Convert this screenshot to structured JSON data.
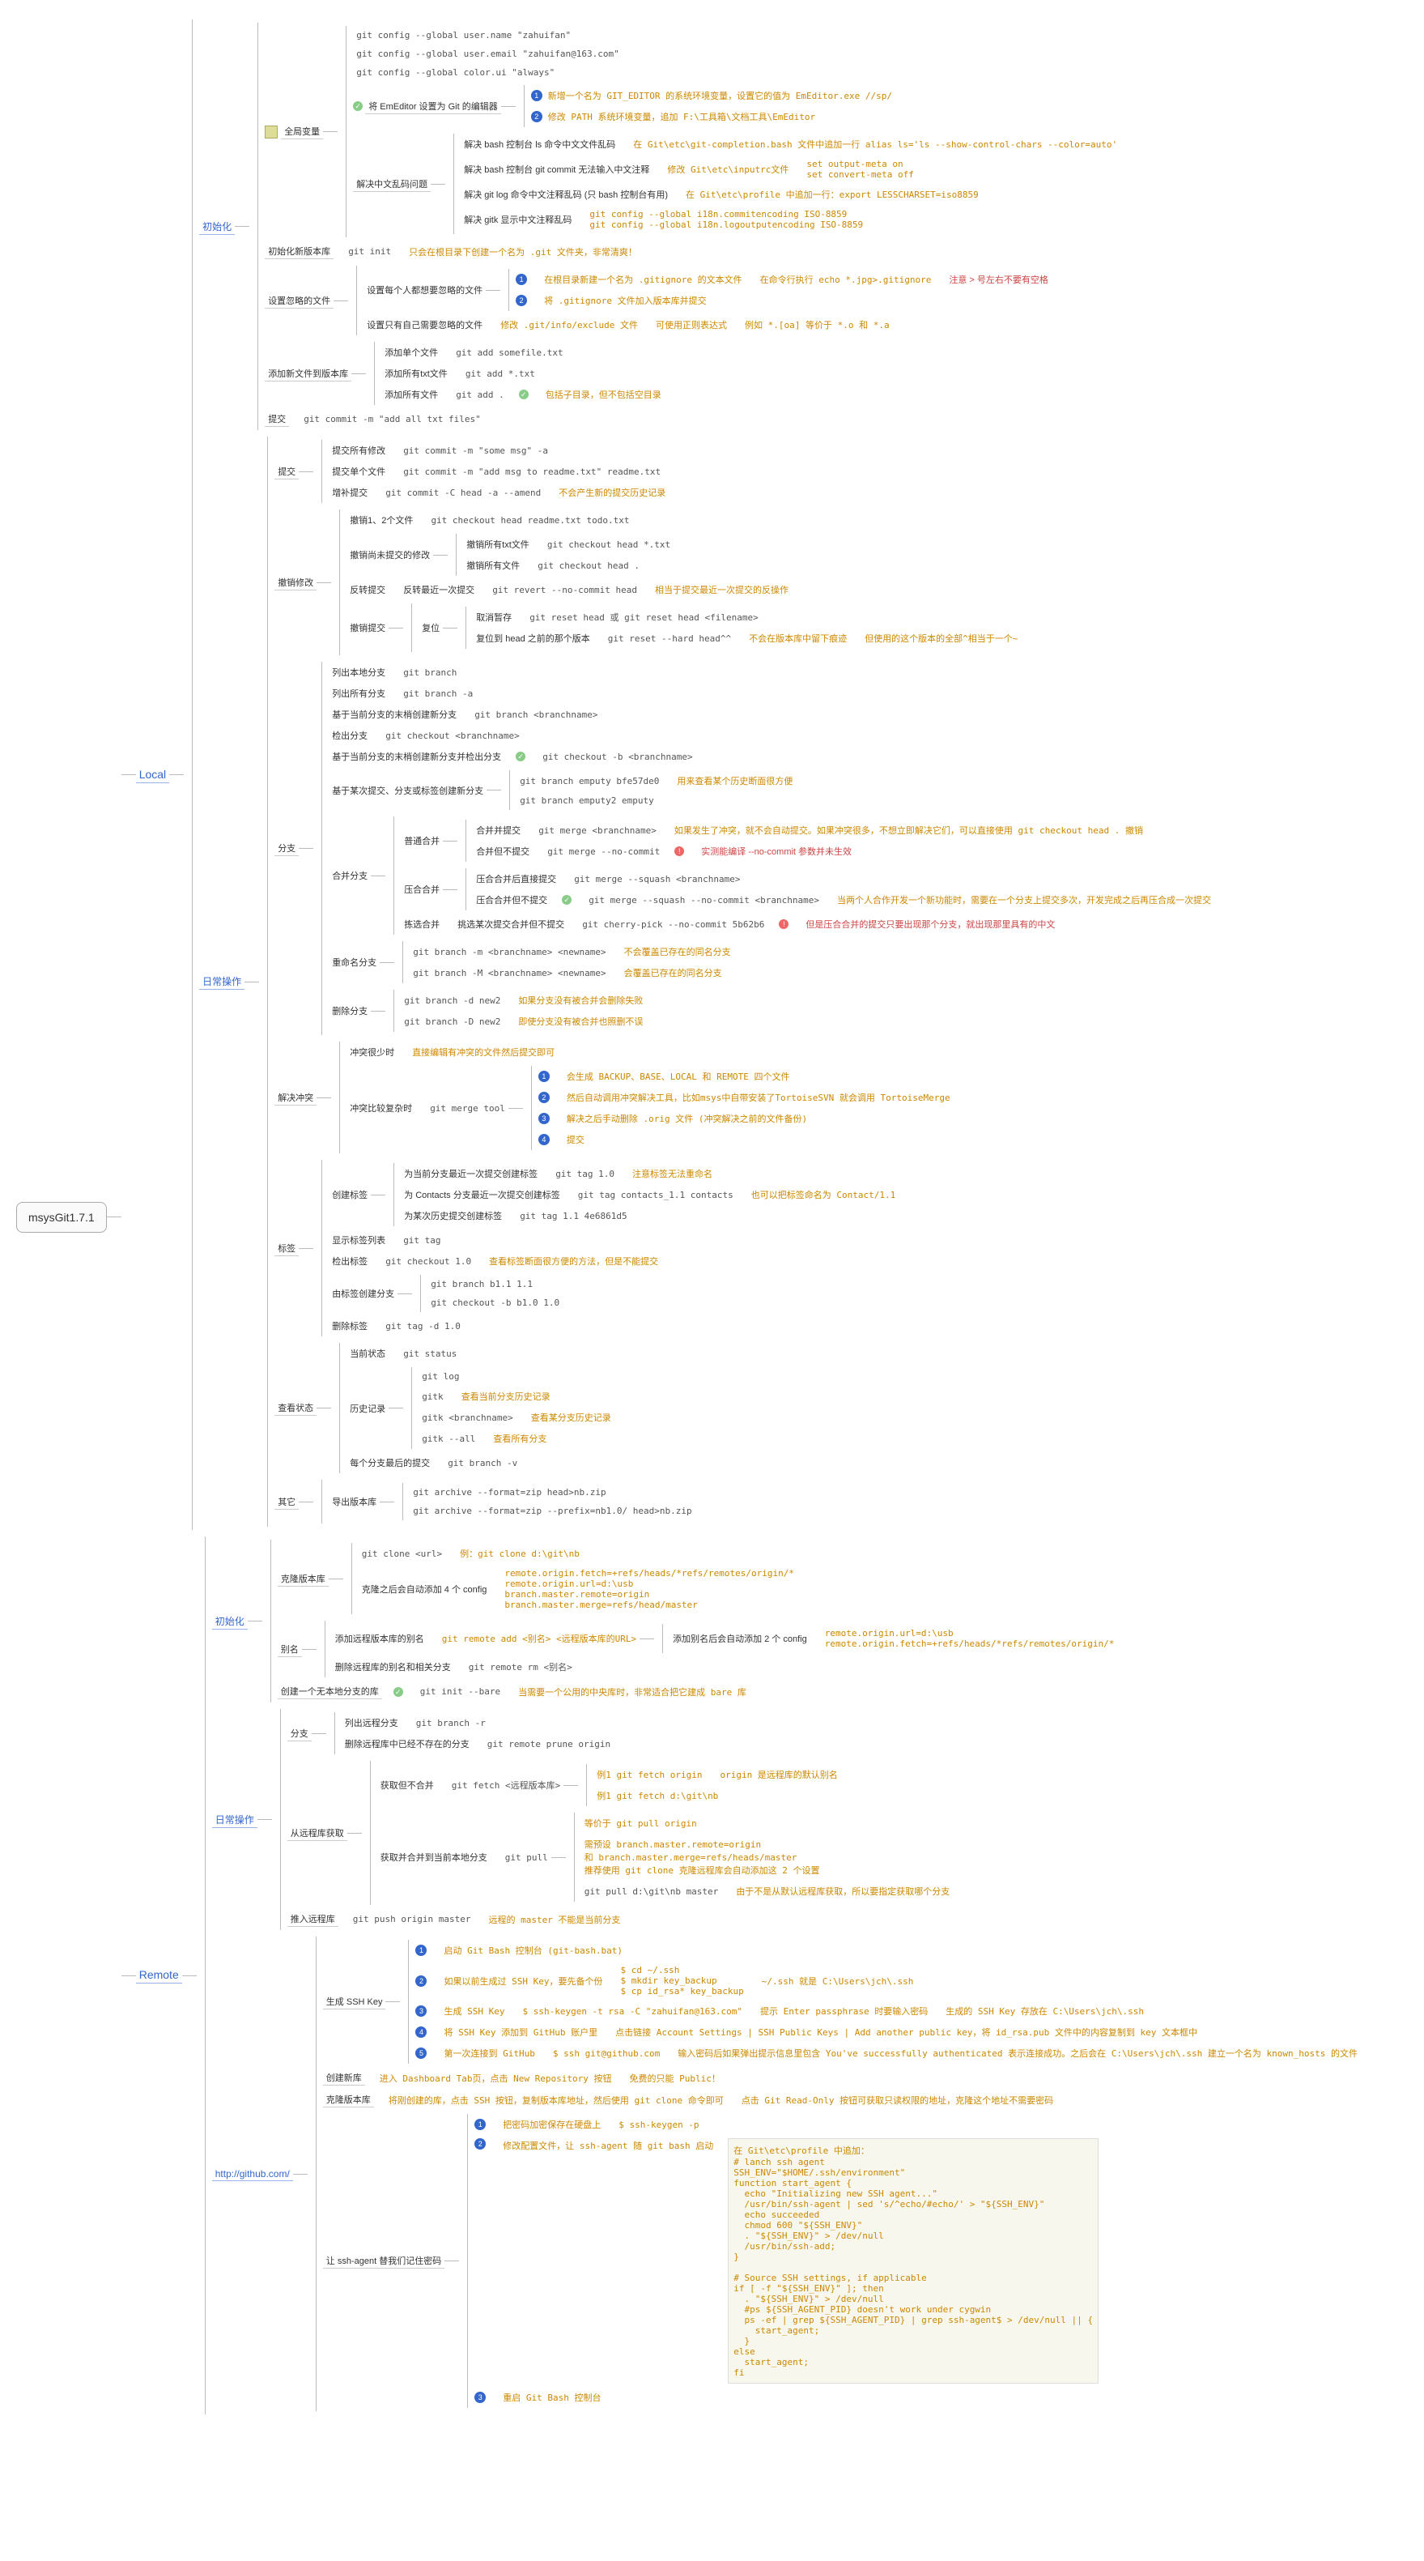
{
  "root": {
    "title": "msysGit1.7.1"
  },
  "local": {
    "title": "Local",
    "init": {
      "title": "初始化",
      "global": {
        "title": "全局变量",
        "cmds": [
          "git config --global user.name \"zahuifan\"",
          "git config --global user.email \"zahuifan@163.com\"",
          "git config --global color.ui \"always\""
        ],
        "editor": {
          "label": "将 EmEditor 设置为 Git 的编辑器",
          "s1": "新增一个名为 GIT_EDITOR 的系统环境变量，设置它的值为 EmEditor.exe //sp/",
          "s2": "修改 PATH 系统环境变量，追加 F:\\工具箱\\文档工具\\EmEditor"
        },
        "zh": {
          "label": "解决中文乱码问题",
          "r1": {
            "l": "解决 bash 控制台 ls 命令中文文件乱码",
            "c": "在 Git\\etc\\git-completion.bash 文件中追加一行 alias ls='ls --show-control-chars --color=auto'"
          },
          "r2": {
            "l": "解决 bash 控制台 git commit 无法输入中文注释",
            "c1": "修改 Git\\etc\\inputrc文件",
            "c2": "set output-meta on\nset convert-meta off"
          },
          "r3": {
            "l": "解决 git log 命令中文注释乱码 (只 bash 控制台有用)",
            "c": "在 Git\\etc\\profile 中追加一行：export LESSCHARSET=iso8859"
          },
          "r4": {
            "l": "解决 gitk 显示中文注释乱码",
            "c": "git config --global i18n.commitencoding ISO-8859\ngit config --global i18n.logoutputencoding ISO-8859"
          }
        }
      },
      "newrepo": {
        "title": "初始化新版本库",
        "cmd": "git init",
        "note": "只会在根目录下创建一个名为 .git 文件夹，非常清爽！"
      },
      "ignore": {
        "title": "设置忽略的文件",
        "common": {
          "l": "设置每个人都想要忽略的文件",
          "s1": "在根目录新建一个名为 .gitignore 的文本文件",
          "s1c": "在命令行执行 echo *.jpg>.gitignore",
          "s1n": "注意 > 号左右不要有空格",
          "s2": "将 .gitignore 文件加入版本库并提交"
        },
        "self": {
          "l": "设置只有自己需要忽略的文件",
          "c": "修改 .git/info/exclude 文件",
          "n": "可使用正则表达式",
          "e": "例如 *.[oa] 等价于 *.o 和 *.a"
        }
      },
      "add": {
        "title": "添加新文件到版本库",
        "r1": {
          "l": "添加单个文件",
          "c": "git add somefile.txt"
        },
        "r2": {
          "l": "添加所有txt文件",
          "c": "git add *.txt"
        },
        "r3": {
          "l": "添加所有文件",
          "c": "git add .",
          "n": "包括子目录，但不包括空目录"
        }
      },
      "commit": {
        "title": "提交",
        "c": "git commit -m \"add all txt files\""
      }
    },
    "daily": {
      "title": "日常操作",
      "commit": {
        "title": "提交",
        "r1": {
          "l": "提交所有修改",
          "c": "git commit -m \"some msg\" -a"
        },
        "r2": {
          "l": "提交单个文件",
          "c": "git commit -m \"add msg to readme.txt\" readme.txt"
        },
        "r3": {
          "l": "增补提交",
          "c": "git commit -C head -a --amend",
          "n": "不会产生新的提交历史记录"
        }
      },
      "undo": {
        "title": "撤销修改",
        "r1": {
          "l": "撤销1、2个文件",
          "c": "git checkout head readme.txt todo.txt"
        },
        "r2": {
          "l": "撤销尚未提交的修改",
          "sub1": {
            "l": "撤销所有txt文件",
            "c": "git checkout head *.txt"
          },
          "sub2": {
            "l": "撤销所有文件",
            "c": "git checkout head ."
          }
        },
        "r3": {
          "l": "反转提交",
          "sub": {
            "l": "反转最近一次提交",
            "c": "git revert --no-commit head",
            "n": "相当于提交最近一次提交的反操作"
          }
        },
        "r4": {
          "l": "撤销提交",
          "sub1": {
            "l": "复位",
            "sub11": {
              "l": "取消暂存",
              "c": "git reset head 或 git reset head <filename>"
            },
            "sub12": {
              "l": "复位到 head 之前的那个版本",
              "c": "git reset --hard head^^",
              "n1": "不会在版本库中留下痕迹",
              "n2": "但使用的这个版本的全部^相当于一个~"
            }
          }
        }
      },
      "branch": {
        "title": "分支",
        "list": {
          "l": "列出本地分支",
          "c": "git branch"
        },
        "lista": {
          "l": "列出所有分支",
          "c": "git branch -a"
        },
        "new": {
          "l": "基于当前分支的末梢创建新分支",
          "c": "git branch <branchname>"
        },
        "co": {
          "l": "检出分支",
          "c": "git checkout <branchname>"
        },
        "newco": {
          "l": "基于当前分支的末梢创建新分支并检出分支",
          "c": "git checkout -b <branchname>"
        },
        "base": {
          "l": "基于某次提交、分支或标签创建新分支",
          "c1": "git branch emputy bfe57de0",
          "n1": "用来查看某个历史断面很方便",
          "c2": "git branch emputy2 emputy"
        },
        "merge": {
          "title": "合并分支",
          "m1": {
            "l": "普通合并",
            "s1": {
              "l": "合并并提交",
              "c": "git merge <branchname>",
              "n": "如果发生了冲突，就不会自动提交。如果冲突很多，不想立即解决它们，可以直接使用 git checkout head . 撤销"
            },
            "s2": {
              "l": "合并但不提交",
              "c": "git merge --no-commit",
              "w": "实测能编译 --no-commit 参数并未生效"
            }
          },
          "m2": {
            "l": "压合合并",
            "s1": {
              "l": "压合合并后直接提交",
              "c": "git merge --squash <branchname>"
            },
            "s2": {
              "l": "压合合并但不提交",
              "c": "git merge --squash --no-commit <branchname>",
              "n": "当两个人合作开发一个新功能时，需要在一个分支上提交多次，开发完成之后再压合成一次提交"
            }
          },
          "m3": {
            "l": "拣选合并",
            "s": {
              "l": "挑选某次提交合并但不提交",
              "c": "git cherry-pick --no-commit 5b62b6",
              "w": "但是压合合并的提交只要出现那个分支，就出现那里具有的中文"
            }
          }
        },
        "rename": {
          "title": "重命名分支",
          "c1": {
            "c": "git branch -m <branchname> <newname>",
            "n": "不会覆盖已存在的同名分支"
          },
          "c2": {
            "c": "git branch -M <branchname> <newname>",
            "n": "会覆盖已存在的同名分支"
          }
        },
        "del": {
          "title": "删除分支",
          "c1": {
            "c": "git branch -d new2",
            "n": "如果分支没有被合并会删除失败"
          },
          "c2": {
            "c": "git branch -D new2",
            "n": "即使分支没有被合并也照删不误"
          }
        }
      },
      "conflict": {
        "title": "解决冲突",
        "r1": {
          "l": "冲突很少时",
          "n": "直接编辑有冲突的文件然后提交即可"
        },
        "r2": {
          "l": "冲突比较复杂时",
          "c": "git merge tool",
          "s1": "会生成 BACKUP、BASE、LOCAL 和 REMOTE 四个文件",
          "s2": "然后自动调用冲突解决工具，比如msys中自带安装了TortoiseSVN 就会调用 TortoiseMerge",
          "s3": "解决之后手动删除 .orig 文件 (冲突解决之前的文件备份)",
          "s4": "提交"
        }
      },
      "tag": {
        "title": "标签",
        "new": {
          "title": "创建标签",
          "r1": {
            "l": "为当前分支最近一次提交创建标签",
            "c": "git tag 1.0",
            "n": "注意标签无法重命名"
          },
          "r2": {
            "l": "为 Contacts 分支最近一次提交创建标签",
            "c": "git tag contacts_1.1 contacts",
            "n": "也可以把标签命名为 Contact/1.1"
          },
          "r3": {
            "l": "为某次历史提交创建标签",
            "c": "git tag 1.1 4e6861d5"
          }
        },
        "show": {
          "l": "显示标签列表",
          "c": "git tag"
        },
        "coTag": {
          "l": "检出标签",
          "c": "git checkout 1.0",
          "n": "查看标签断面很方便的方法，但是不能提交"
        },
        "fromTag": {
          "l": "由标签创建分支",
          "c1": "git branch b1.1 1.1",
          "c2": "git checkout -b b1.0 1.0"
        },
        "delTag": {
          "l": "删除标签",
          "c": "git tag -d 1.0"
        }
      },
      "status": {
        "title": "查看状态",
        "cur": {
          "l": "当前状态",
          "c": "git status"
        },
        "hist": {
          "l": "历史记录",
          "c": "git log",
          "sub1": {
            "l": "gitk",
            "n": "查看当前分支历史记录"
          },
          "sub2": {
            "l": "gitk <branchname>",
            "n": "查看某分支历史记录"
          },
          "sub3": {
            "l": "gitk --all",
            "n": "查看所有分支"
          }
        },
        "last": {
          "l": "每个分支最后的提交",
          "c": "git branch -v"
        }
      },
      "other": {
        "title": "其它",
        "export": {
          "l": "导出版本库",
          "c1": "git archive --format=zip head>nb.zip",
          "c2": "git archive --format=zip --prefix=nb1.0/ head>nb.zip"
        }
      }
    }
  },
  "remote": {
    "title": "Remote",
    "init": {
      "title": "初始化",
      "clone": {
        "title": "克隆版本库",
        "c": "git clone <url>",
        "e": "例：git clone d:\\git\\nb",
        "cfg": {
          "l": "克隆之后会自动添加 4 个 config",
          "v": "remote.origin.fetch=+refs/heads/*refs/remotes/origin/*\nremote.origin.url=d:\\usb\nbranch.master.remote=origin\nbranch.master.merge=refs/head/master"
        }
      },
      "alias": {
        "title": "别名",
        "add": {
          "l": "添加远程版本库的别名",
          "c": "git remote add <别名> <远程版本库的URL>",
          "cfg": {
            "l": "添加别名后会自动添加 2 个 config",
            "v": "remote.origin.url=d:\\usb\nremote.origin.fetch=+refs/heads/*refs/remotes/origin/*"
          }
        },
        "del": {
          "l": "删除远程库的别名和相关分支",
          "c": "git remote rm <别名>"
        }
      },
      "bare": {
        "title": "创建一个无本地分支的库",
        "c": "git init --bare",
        "n": "当需要一个公用的中央库时，非常适合把它建成 bare 库"
      }
    },
    "daily": {
      "title": "日常操作",
      "branch": {
        "title": "分支",
        "list": {
          "l": "列出远程分支",
          "c": "git branch -r"
        },
        "prune": {
          "l": "删除远程库中已经不存在的分支",
          "c": "git remote prune origin"
        }
      },
      "fetch": {
        "title": "从远程库获取",
        "f1": {
          "l": "获取但不合并",
          "c": "git fetch <远程版本库>",
          "e1": "例1 git fetch origin",
          "n1": "origin 是远程库的默认别名",
          "e2": "例1 git fetch d:\\git\\nb"
        },
        "f2": {
          "l": "获取并合并到当前本地分支",
          "c": "git pull",
          "n0": "等价于 git pull origin",
          "n1": "需预设 branch.master.remote=origin\n和 branch.master.merge=refs/heads/master\n推荐使用 git clone 克隆远程库会自动添加这 2 个设置",
          "c2": "git pull d:\\git\\nb master",
          "n2": "由于不是从默认远程库获取，所以要指定获取哪个分支"
        }
      },
      "push": {
        "title": "推入远程库",
        "c": "git push origin master",
        "n": "远程的 master 不能是当前分支"
      }
    },
    "github": {
      "title": "http://github.com/",
      "ssh": {
        "title": "生成 SSH Key",
        "s1": {
          "l": "启动 Git Bash 控制台 (git-bash.bat)"
        },
        "s2": {
          "l": "如果以前生成过 SSH Key，要先备个份",
          "c": "$ cd ~/.ssh\n$ mkdir key_backup\n$ cp id_rsa* key_backup",
          "n": "~/.ssh 就是 C:\\Users\\jch\\.ssh"
        },
        "s3": {
          "l": "生成 SSH Key",
          "c": "$ ssh-keygen -t rsa -C \"zahuifan@163.com\"",
          "n1": "提示 Enter passphrase 时要输入密码",
          "n2": "生成的 SSH Key 存放在 C:\\Users\\jch\\.ssh"
        },
        "s4": {
          "l": "将 SSH Key 添加到 GitHub 账户里",
          "n": "点击链接 Account Settings | SSH Public Keys | Add another public key，将 id_rsa.pub 文件中的内容复制到 key 文本框中"
        },
        "s5": {
          "l": "第一次连接到 GitHub",
          "c": "$ ssh git@github.com",
          "n": "输入密码后如果弹出提示信息里包含 You've successfully authenticated 表示连接成功。之后会在 C:\\Users\\jch\\.ssh 建立一个名为 known_hosts 的文件"
        }
      },
      "newrepo": {
        "title": "创建新库",
        "n": "进入 Dashboard Tab页，点击 New Repository 按钮",
        "n2": "免费的只能 Public！"
      },
      "clone": {
        "title": "克隆版本库",
        "n": "将刚创建的库，点击 SSH 按钮，复制版本库地址，然后使用 git clone 命令即可",
        "n2": "点击 Git Read-Only 按钮可获取只读权限的地址，克隆这个地址不需要密码"
      },
      "agent": {
        "title": "让 ssh-agent 替我们记住密码",
        "s1": {
          "l": "把密码加密保存在硬盘上",
          "c": "$ ssh-keygen -p"
        },
        "s2": {
          "l": "修改配置文件，让 ssh-agent 随 git bash 启动",
          "code": "在 Git\\etc\\profile 中追加：\n# lanch ssh agent\nSSH_ENV=\"$HOME/.ssh/environment\"\nfunction start_agent {\n  echo \"Initializing new SSH agent...\"\n  /usr/bin/ssh-agent | sed 's/^echo/#echo/' > \"${SSH_ENV}\"\n  echo succeeded\n  chmod 600 \"${SSH_ENV}\"\n  . \"${SSH_ENV}\" > /dev/null\n  /usr/bin/ssh-add;\n}\n\n# Source SSH settings, if applicable\nif [ -f \"${SSH_ENV}\" ]; then\n  . \"${SSH_ENV}\" > /dev/null\n  #ps ${SSH_AGENT_PID} doesn't work under cygwin\n  ps -ef | grep ${SSH_AGENT_PID} | grep ssh-agent$ > /dev/null || {\n    start_agent;\n  }\nelse\n  start_agent;\nfi"
        },
        "s3": {
          "l": "重启 Git Bash 控制台"
        }
      }
    }
  }
}
